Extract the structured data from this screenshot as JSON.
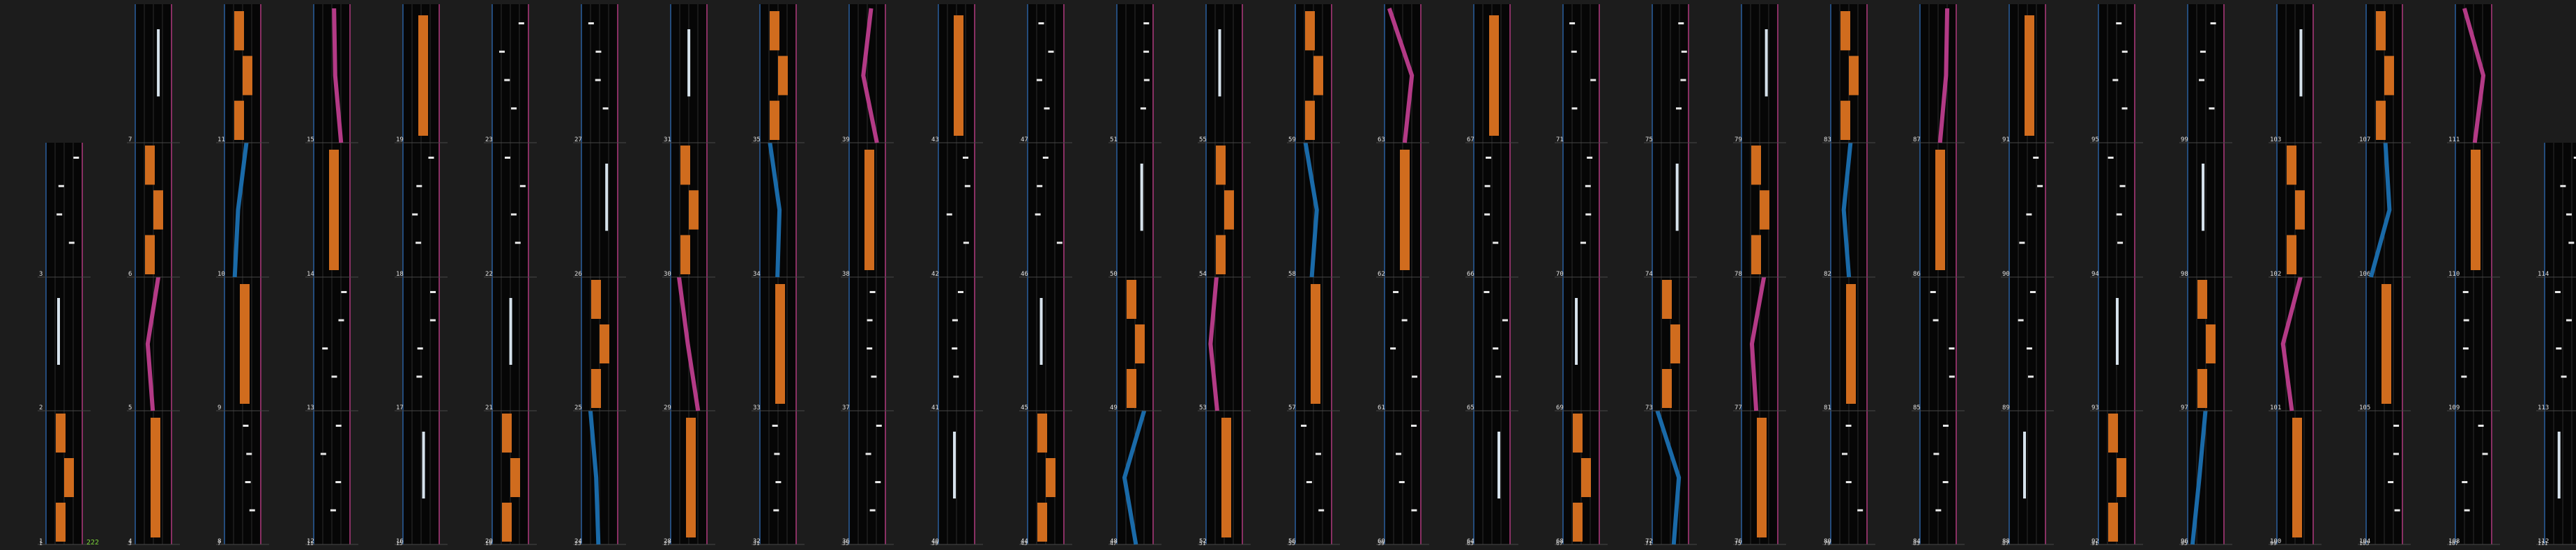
{
  "view": {
    "background": "#1c1c1c",
    "lane_background": "#060606",
    "grid_color": "#2c2c2c",
    "measure_line_color": "#474747",
    "left_edge_color": "#2a5f9e",
    "right_edge_color": "#b03a7e",
    "combo_label": "222",
    "combo_color": "#7cd33a"
  },
  "chart_data": {
    "type": "rhythm-game-chart",
    "measures_per_column": 4,
    "first_measure": 1,
    "last_measure": 114,
    "note_types": {
      "slide_left": {
        "color": "#1a6aa8",
        "description": "blue slide path"
      },
      "slide_right": {
        "color": "#b33a86",
        "description": "magenta slide path"
      },
      "hold": {
        "color": "#d06c1e",
        "description": "orange hold bar"
      },
      "flick": {
        "color": "#d6e2ec",
        "description": "white vertical air line"
      },
      "tap": {
        "color": "#e8e8e8",
        "description": "small white tap"
      }
    },
    "columns": [
      {
        "measures": [
          1,
          2,
          3,
          null
        ]
      },
      {
        "measures": [
          4,
          5,
          6,
          7
        ]
      },
      {
        "measures": [
          8,
          9,
          10,
          11
        ]
      },
      {
        "measures": [
          12,
          13,
          14,
          15
        ]
      },
      {
        "measures": [
          16,
          17,
          18,
          19
        ]
      },
      {
        "measures": [
          20,
          21,
          22,
          23
        ]
      },
      {
        "measures": [
          24,
          25,
          26,
          27
        ]
      },
      {
        "measures": [
          28,
          29,
          30,
          31
        ]
      },
      {
        "measures": [
          32,
          33,
          34,
          35
        ]
      },
      {
        "measures": [
          36,
          37,
          38,
          39
        ]
      },
      {
        "measures": [
          40,
          41,
          42,
          43
        ]
      },
      {
        "measures": [
          44,
          45,
          46,
          47
        ]
      },
      {
        "measures": [
          48,
          49,
          50,
          51
        ]
      },
      {
        "measures": [
          52,
          53,
          54,
          55
        ]
      },
      {
        "measures": [
          56,
          57,
          58,
          59
        ]
      },
      {
        "measures": [
          60,
          61,
          62,
          63
        ]
      },
      {
        "measures": [
          64,
          65,
          66,
          67
        ]
      },
      {
        "measures": [
          68,
          69,
          70,
          71
        ]
      },
      {
        "measures": [
          72,
          73,
          74,
          75
        ]
      },
      {
        "measures": [
          76,
          77,
          78,
          79
        ]
      },
      {
        "measures": [
          80,
          81,
          82,
          83
        ]
      },
      {
        "measures": [
          84,
          85,
          86,
          87
        ]
      },
      {
        "measures": [
          88,
          89,
          90,
          91
        ]
      },
      {
        "measures": [
          92,
          93,
          94,
          95
        ]
      },
      {
        "measures": [
          96,
          97,
          98,
          99
        ]
      },
      {
        "measures": [
          100,
          101,
          102,
          103
        ]
      },
      {
        "measures": [
          104,
          105,
          106,
          107
        ]
      },
      {
        "measures": [
          108,
          109,
          110,
          111
        ]
      },
      {
        "measures": [
          112,
          113,
          114,
          null
        ]
      }
    ],
    "bottom_labels": [
      "1",
      "3",
      "7",
      "11",
      "15",
      "19",
      "23",
      "27",
      "31",
      "35",
      "39",
      "43",
      "47",
      "51",
      "55",
      "59",
      "63",
      "67",
      "71",
      "75",
      "79",
      "83",
      "87",
      "91",
      "95",
      "99",
      "103",
      "107",
      "111"
    ]
  }
}
